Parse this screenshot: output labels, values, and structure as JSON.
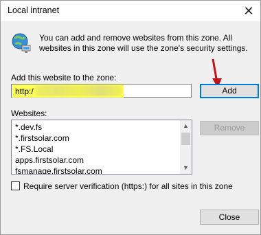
{
  "window": {
    "title": "Local intranet"
  },
  "intro_text": "You can add and remove websites from this zone. All websites in this zone will use the zone's security settings.",
  "add_section": {
    "label": "Add this website to the zone:",
    "input_value": "http:/",
    "add_button": "Add"
  },
  "websites": {
    "label": "Websites:",
    "items": [
      "*.dev.fs",
      "*.firstsolar.com",
      "*.FS.Local",
      "apps.firstsolar.com",
      "fsmanage.firstsolar.com"
    ],
    "remove_button": "Remove"
  },
  "options": {
    "require_verification_label": "Require server verification (https:) for all sites in this zone",
    "require_verification_checked": false
  },
  "footer": {
    "close_button": "Close"
  },
  "colors": {
    "highlight": "#ffff3c",
    "annotation_arrow": "#c0141c",
    "default_button_border": "#0078d7"
  }
}
